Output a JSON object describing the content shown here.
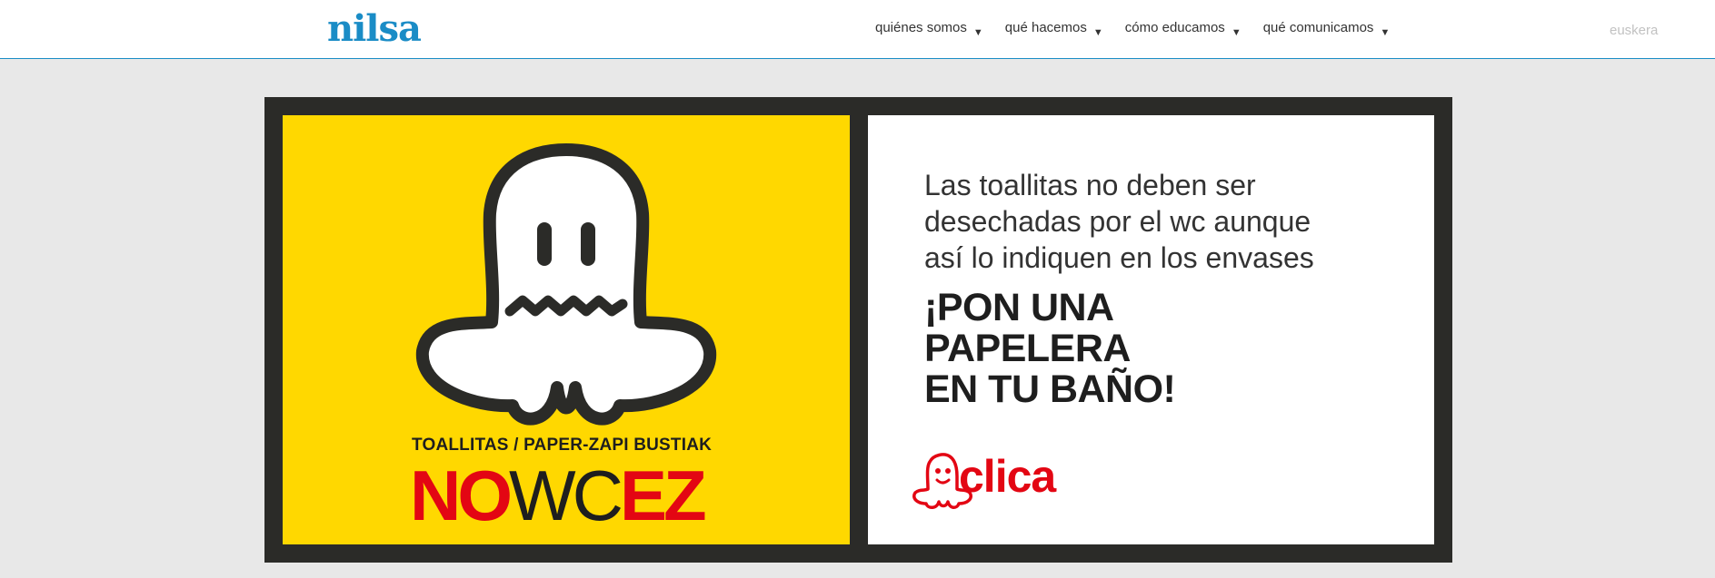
{
  "header": {
    "logo": "nilsa",
    "nav": [
      {
        "label": "quiénes somos",
        "caret": "▼"
      },
      {
        "label": "qué hacemos",
        "caret": "▼"
      },
      {
        "label": "cómo educamos",
        "caret": "▼"
      },
      {
        "label": "qué comunicamos",
        "caret": "▼"
      }
    ],
    "language": "euskera"
  },
  "banner": {
    "left": {
      "tagline": "TOALLITAS / PAPER-ZAPI BUSTIAK",
      "slogan_no": "NO",
      "slogan_wc": "WC",
      "slogan_ez": "EZ",
      "illustration": "ghost-icon"
    },
    "right": {
      "info_lines": [
        "Las toallitas no deben ser",
        "desechadas por el wc aunque",
        "así lo indiquen en los envases"
      ],
      "cta_lines": [
        "¡PON UNA",
        "PAPELERA",
        "EN TU BAÑO!"
      ],
      "brand": "clica",
      "brand_icon": "ghost-icon"
    }
  },
  "colors": {
    "brand_blue": "#1a8cc6",
    "yellow": "#ffd800",
    "red": "#e30613",
    "dark": "#2b2b28"
  }
}
